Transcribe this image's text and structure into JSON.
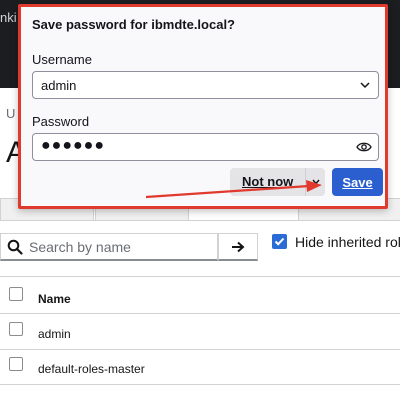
{
  "page": {
    "topbar_fragment": "nki",
    "breadcrumb_fragment": "U",
    "title_fragment": "A",
    "search": {
      "placeholder": "Search by name"
    },
    "hide_inherited_label": "Hide inherited role",
    "hide_inherited_checked": true,
    "table": {
      "columns": [
        "Name"
      ],
      "rows": [
        {
          "name": "admin"
        },
        {
          "name": "default-roles-master"
        }
      ]
    }
  },
  "popup": {
    "title": "Save password for ibmdte.local?",
    "username_label": "Username",
    "username_value": "admin",
    "password_label": "Password",
    "password_masked": "●●●●●●",
    "not_now_label": "Not now",
    "save_label": "Save"
  },
  "icons": {
    "search": "search-icon",
    "arrow_right": "arrow-right-icon",
    "chevron_down": "chevron-down-icon",
    "eye": "eye-icon",
    "checkmark": "checkmark-icon"
  },
  "colors": {
    "highlight_border": "#e0392e",
    "save_button": "#2b5fd0",
    "checkbox_checked": "#2b6bd6",
    "topbar": "#1b1d21"
  }
}
